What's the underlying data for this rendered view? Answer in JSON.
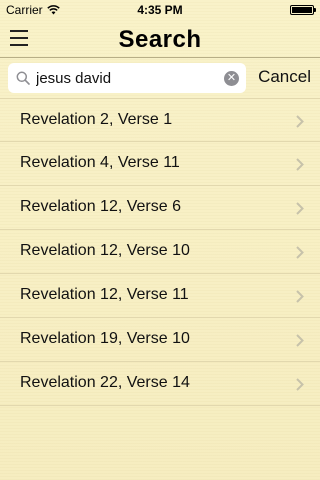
{
  "status_bar": {
    "carrier": "Carrier",
    "time": "4:35 PM",
    "battery_level": 1.0
  },
  "nav": {
    "title": "Search",
    "menu_icon": "hamburger-menu-icon"
  },
  "search": {
    "value": "jesus david",
    "placeholder": "",
    "cancel_label": "Cancel",
    "search_icon": "magnifier-icon",
    "clear_icon": "clear-x-icon"
  },
  "results": [
    {
      "label": "Revelation 2, Verse 1"
    },
    {
      "label": "Revelation 4, Verse 11"
    },
    {
      "label": "Revelation 12, Verse 6"
    },
    {
      "label": "Revelation 12, Verse 10"
    },
    {
      "label": "Revelation 12, Verse 11"
    },
    {
      "label": "Revelation 19, Verse 10"
    },
    {
      "label": "Revelation 22, Verse 14"
    }
  ],
  "colors": {
    "background": "#f8f0c4",
    "separator": "#e2d8ae"
  }
}
